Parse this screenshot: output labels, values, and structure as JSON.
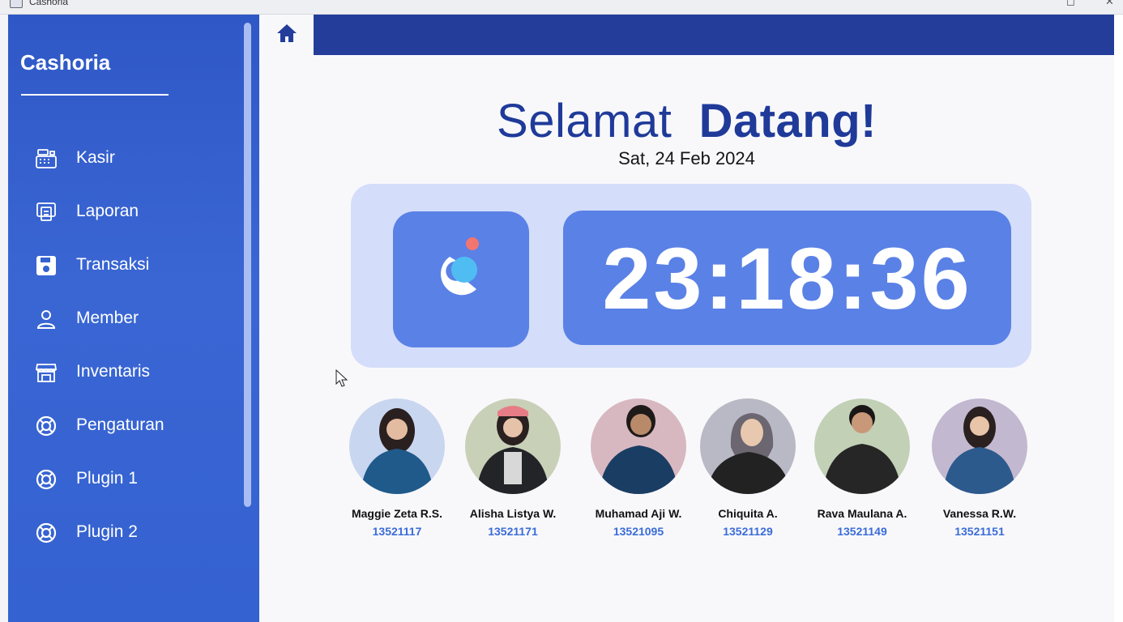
{
  "window": {
    "title": "Cashoria"
  },
  "sidebar": {
    "brand": "Cashoria",
    "items": [
      {
        "label": "Kasir",
        "icon": "cash-register-icon"
      },
      {
        "label": "Laporan",
        "icon": "report-icon"
      },
      {
        "label": "Transaksi",
        "icon": "save-icon"
      },
      {
        "label": "Member",
        "icon": "user-icon"
      },
      {
        "label": "Inventaris",
        "icon": "store-icon"
      },
      {
        "label": "Pengaturan",
        "icon": "lifebuoy-icon"
      },
      {
        "label": "Plugin 1",
        "icon": "lifebuoy-icon"
      },
      {
        "label": "Plugin 2",
        "icon": "lifebuoy-icon"
      }
    ]
  },
  "header": {
    "home_icon": "home-icon"
  },
  "main": {
    "welcome_light": "Selamat",
    "welcome_bold": "Datang!",
    "date": "Sat, 24 Feb 2024",
    "time": "23:18:36"
  },
  "team": [
    {
      "name": "Maggie Zeta R.S.",
      "nim": "13521117"
    },
    {
      "name": "Alisha Listya W.",
      "nim": "13521171"
    },
    {
      "name": "Muhamad Aji W.",
      "nim": "13521095"
    },
    {
      "name": "Chiquita A.",
      "nim": "13521129"
    },
    {
      "name": "Rava Maulana A.",
      "nim": "13521149"
    },
    {
      "name": "Vanessa R.W.",
      "nim": "13521151"
    }
  ],
  "colors": {
    "sidebar": "#3462d0",
    "topbar": "#243d9b",
    "accent": "#5a81e6",
    "panel": "#d4ddfa",
    "heading": "#1f3a99"
  }
}
